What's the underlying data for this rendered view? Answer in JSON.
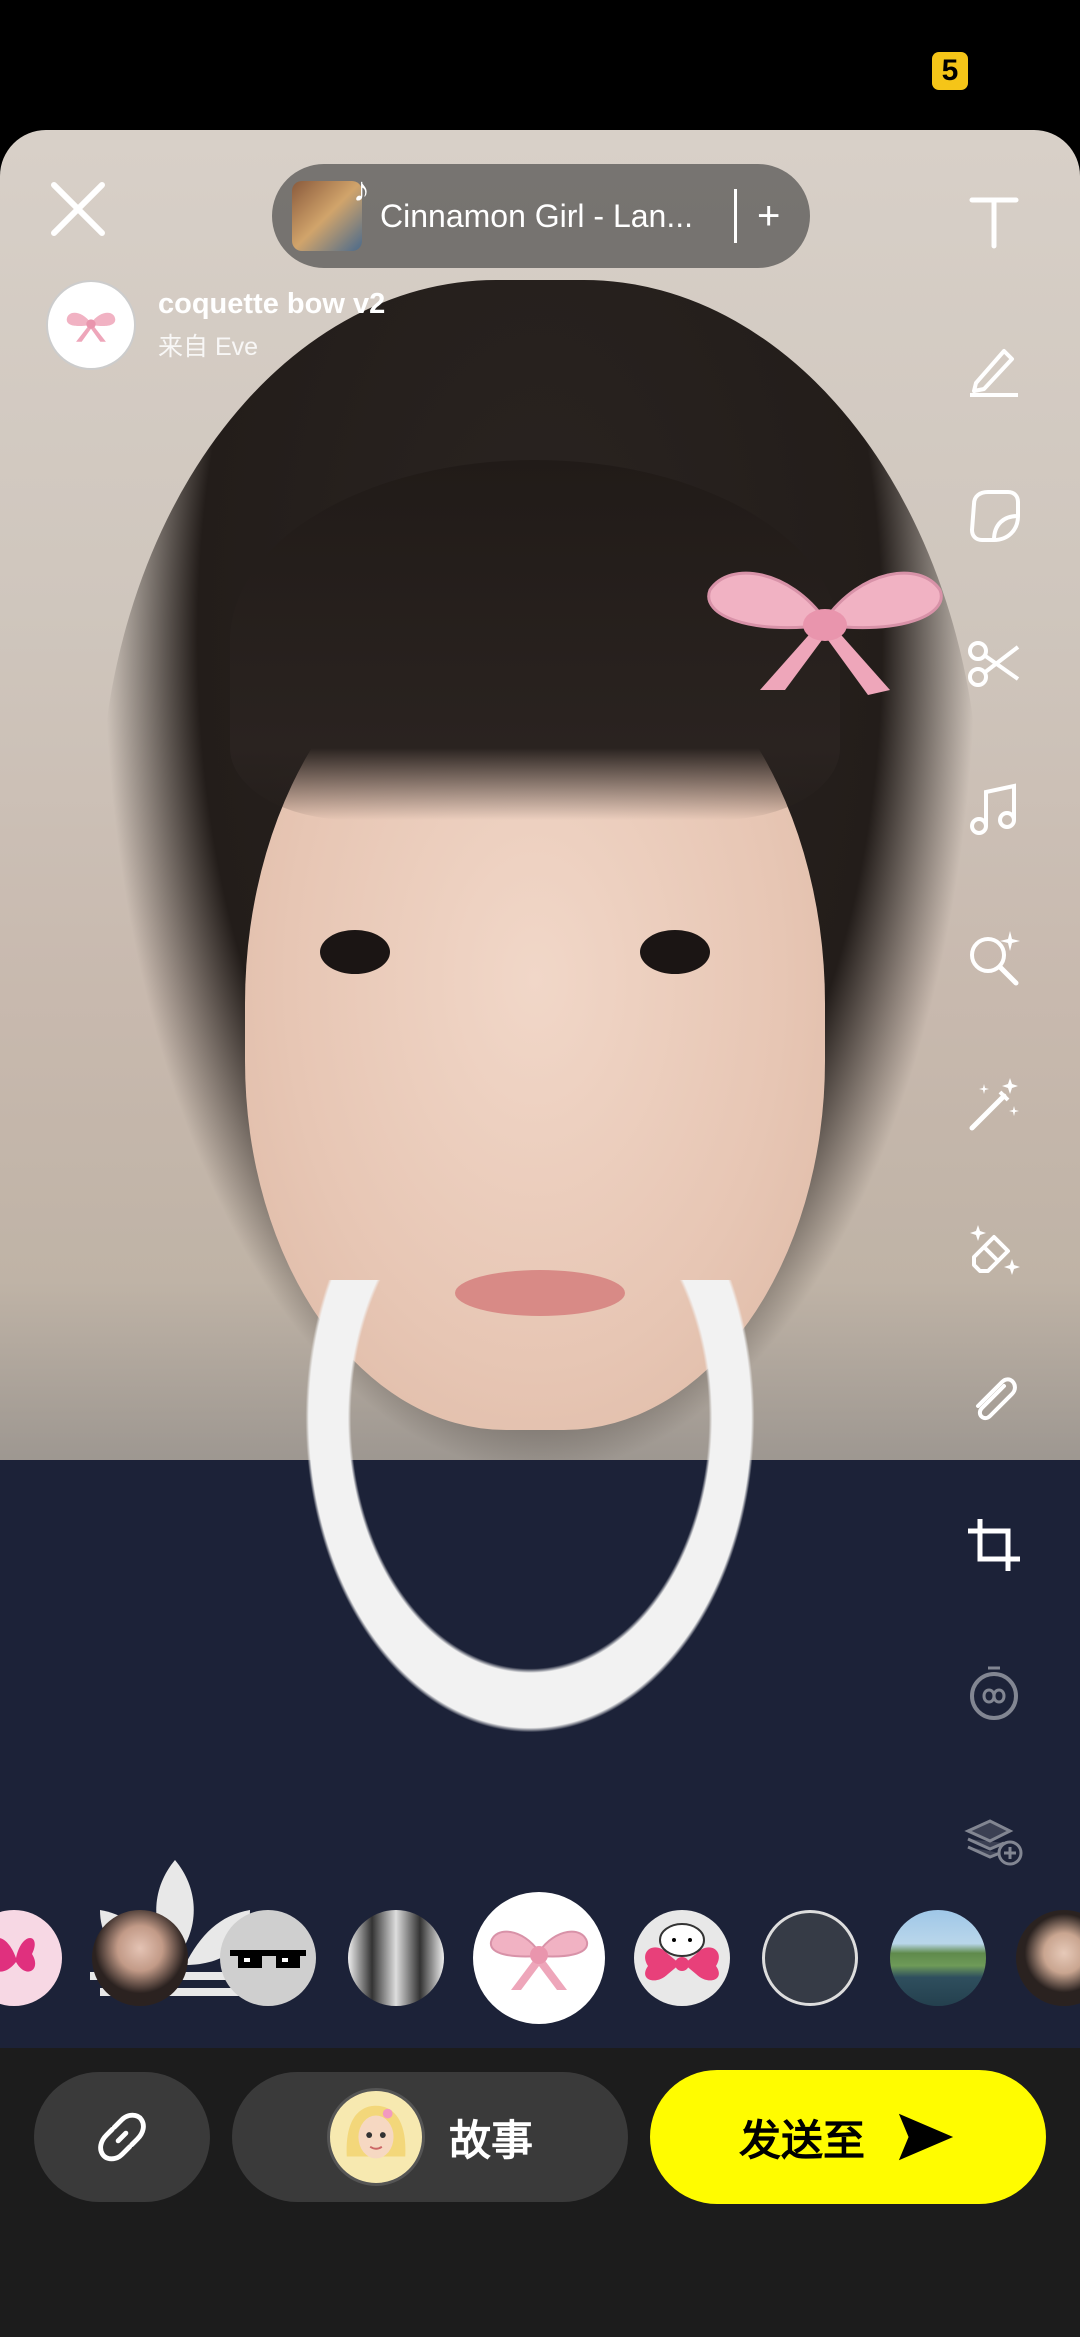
{
  "status_bar": {
    "badge": "5"
  },
  "music": {
    "title": "Cinnamon Girl - Lan...",
    "add_symbol": "+"
  },
  "lens": {
    "name": "coquette bow v2",
    "from": "来自 Eve"
  },
  "toolbar": {
    "icons": [
      "text-icon",
      "pencil-icon",
      "sticker-icon",
      "scissors-icon",
      "music-icon",
      "search-sparkle-icon",
      "magic-wand-icon",
      "eraser-sparkle-icon",
      "paperclip-icon",
      "crop-icon",
      "timer-icon",
      "layers-add-icon"
    ]
  },
  "carousel": {
    "items": [
      "butterfly-lens",
      "portrait-lens",
      "sunglasses-lens",
      "mirror-lens",
      "coquette-bow-lens",
      "hello-kitty-lens",
      "blank-lens",
      "landscape-lens",
      "girl-portrait-lens"
    ],
    "selected_index": 4
  },
  "bottom": {
    "story_label": "故事",
    "send_label": "发送至"
  },
  "colors": {
    "send_button": "#fffc00",
    "bottom_bar": "#1c1c1c",
    "pill": "#3a3a3a",
    "bow": "#f1b2c3"
  }
}
